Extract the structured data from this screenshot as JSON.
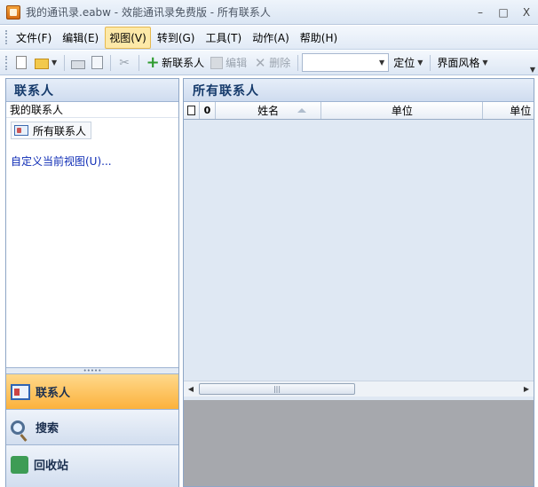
{
  "window": {
    "title": "我的通讯录.eabw - 效能通讯录免费版 - 所有联系人",
    "minimize": "–",
    "maximize": "□",
    "close": "X"
  },
  "menu": [
    {
      "label": "文件(F)",
      "active": false
    },
    {
      "label": "编辑(E)",
      "active": false
    },
    {
      "label": "视图(V)",
      "active": true
    },
    {
      "label": "转到(G)",
      "active": false
    },
    {
      "label": "工具(T)",
      "active": false
    },
    {
      "label": "动作(A)",
      "active": false
    },
    {
      "label": "帮助(H)",
      "active": false
    }
  ],
  "toolbar": {
    "new_contact": "新联系人",
    "edit": "编辑",
    "delete": "删除",
    "search_value": "",
    "locate": "定位",
    "ui_style": "界面风格"
  },
  "left_pane": {
    "title": "联系人",
    "section_label": "我的联系人",
    "folder": "所有联系人",
    "custom_view_link": "自定义当前视图(U)...",
    "nav": {
      "contacts": "联系人",
      "search": "搜索",
      "recycle": "回收站"
    }
  },
  "right_pane": {
    "title": "所有联系人",
    "columns": {
      "name": "姓名",
      "unit": "单位",
      "unit2": "单位"
    },
    "rows": []
  },
  "colors": {
    "accent_active_nav": "#fbb23c",
    "pane_header_text": "#153a6b",
    "link": "#0d2bb5",
    "preview_bg": "#a6a8ad"
  }
}
